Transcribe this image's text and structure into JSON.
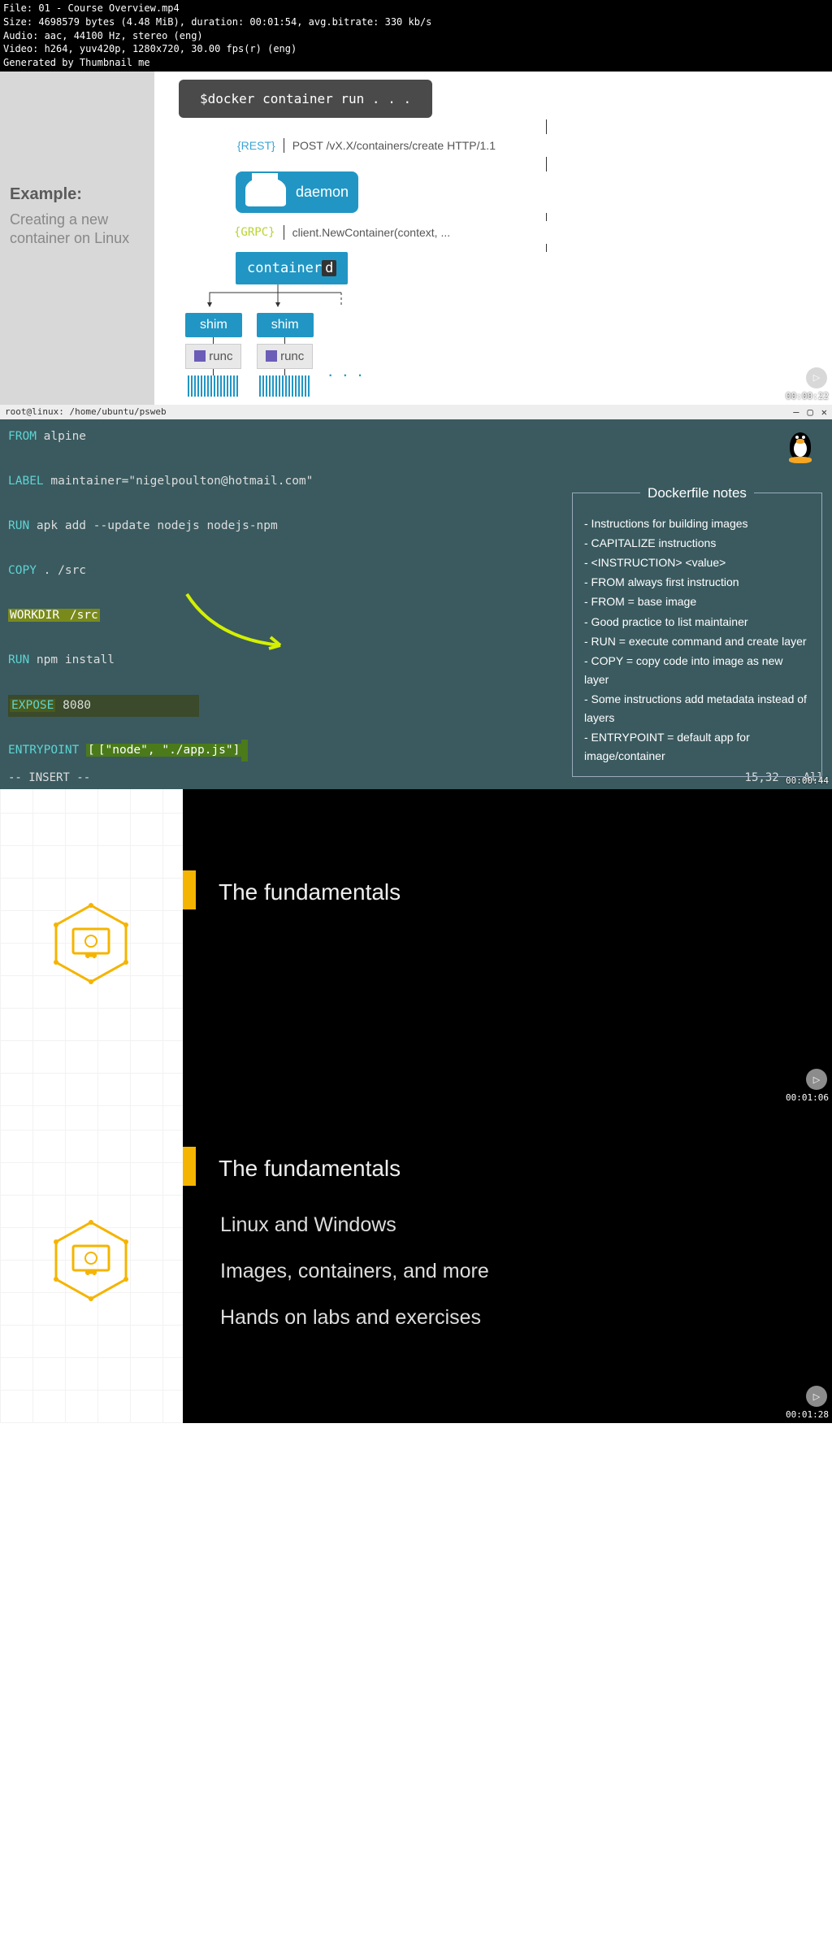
{
  "meta": {
    "file": "File: 01 - Course Overview.mp4",
    "size": "Size: 4698579 bytes (4.48 MiB), duration: 00:01:54, avg.bitrate: 330 kb/s",
    "audio": "Audio: aac, 44100 Hz, stereo (eng)",
    "video": "Video: h264, yuv420p, 1280x720, 30.00 fps(r) (eng)",
    "gen": "Generated by Thumbnail me"
  },
  "frame1": {
    "example_label": "Example:",
    "example_desc": "Creating a new container on Linux",
    "cmd": "$docker container run . . .",
    "rest": "{REST}",
    "post": "POST /vX.X/containers/create HTTP/1.1",
    "daemon": "daemon",
    "grpc": "{GRPC}",
    "grpc_call": "client.NewContainer(context, ...",
    "containerd": "container",
    "containerd_d": "d",
    "shim": "shim",
    "runc": "runc",
    "dots": ". . .",
    "timestamp": "00:00:22"
  },
  "frame2": {
    "titlebar": "root@linux: /home/ubuntu/psweb",
    "code": {
      "from": "FROM",
      "from_val": " alpine",
      "label": "LABEL",
      "label_val": " maintainer=\"nigelpoulton@hotmail.com\"",
      "run1": "RUN",
      "run1_val": " apk add --update nodejs nodejs-npm",
      "copy": "COPY",
      "copy_val": " . /src",
      "workdir": "WORKDIR",
      "workdir_val": " /src",
      "run2": "RUN",
      "run2_val": " npm install",
      "expose": "EXPOSE",
      "expose_val": " 8080",
      "entrypoint": "ENTRYPOINT",
      "entrypoint_val": "[\"node\", \"./app.js\"]"
    },
    "notes_title": "Dockerfile notes",
    "notes": [
      "- Instructions for building images",
      "- CAPITALIZE instructions",
      "- <INSTRUCTION> <value>",
      "- FROM always first instruction",
      "- FROM = base image",
      "- Good practice to list maintainer",
      "- RUN = execute command and create layer",
      "- COPY = copy code into image as new layer",
      "- Some instructions add metadata instead of layers",
      "- ENTRYPOINT = default app for image/container"
    ],
    "status_insert": "-- INSERT --",
    "status_pos": "15,32",
    "status_all": "All",
    "timestamp": "00:00:44"
  },
  "frame3": {
    "heading": "The fundamentals",
    "timestamp": "00:01:06"
  },
  "frame4": {
    "heading": "The fundamentals",
    "lines": [
      "Linux and Windows",
      "Images, containers, and more",
      "Hands on labs and exercises"
    ],
    "timestamp": "00:01:28"
  }
}
